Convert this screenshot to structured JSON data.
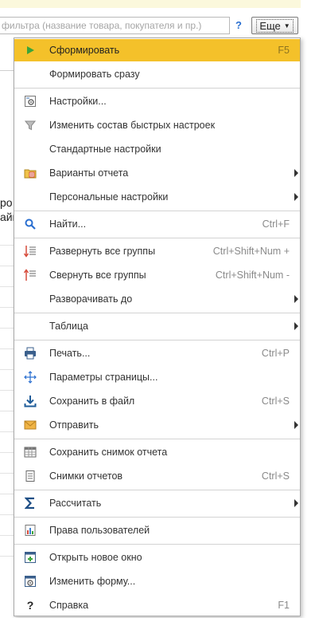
{
  "background": {
    "search_placeholder": "фильтра (название товара, покупателя и пр.)",
    "help_label": "?",
    "more_button_label": "Еще",
    "partial_text_1": "ро",
    "partial_text_2": "айм"
  },
  "menu": {
    "items": [
      {
        "label": "Сформировать",
        "shortcut": "F5",
        "icon": "play-icon"
      },
      {
        "label": "Формировать сразу",
        "shortcut": "",
        "icon": ""
      },
      {
        "label": "Настройки...",
        "shortcut": "",
        "icon": "settings-icon"
      },
      {
        "label": "Изменить состав быстрых настроек",
        "shortcut": "",
        "icon": "filter-icon"
      },
      {
        "label": "Стандартные настройки",
        "shortcut": "",
        "icon": ""
      },
      {
        "label": "Варианты отчета",
        "shortcut": "",
        "icon": "report-variants-icon",
        "submenu": true
      },
      {
        "label": "Персональные настройки",
        "shortcut": "",
        "icon": "",
        "submenu": true
      },
      {
        "label": "Найти...",
        "shortcut": "Ctrl+F",
        "icon": "search-icon"
      },
      {
        "label": "Развернуть все группы",
        "shortcut": "Ctrl+Shift+Num +",
        "icon": "expand-groups-icon"
      },
      {
        "label": "Свернуть все группы",
        "shortcut": "Ctrl+Shift+Num -",
        "icon": "collapse-groups-icon"
      },
      {
        "label": "Разворачивать до",
        "shortcut": "",
        "icon": "",
        "submenu": true
      },
      {
        "label": "Таблица",
        "shortcut": "",
        "icon": "",
        "submenu": true
      },
      {
        "label": "Печать...",
        "shortcut": "Ctrl+P",
        "icon": "print-icon"
      },
      {
        "label": "Параметры страницы...",
        "shortcut": "",
        "icon": "page-setup-icon"
      },
      {
        "label": "Сохранить в файл",
        "shortcut": "Ctrl+S",
        "icon": "save-file-icon"
      },
      {
        "label": "Отправить",
        "shortcut": "",
        "icon": "mail-icon",
        "submenu": true
      },
      {
        "label": "Сохранить снимок отчета",
        "shortcut": "",
        "icon": "snapshot-save-icon"
      },
      {
        "label": "Снимки отчетов",
        "shortcut": "Ctrl+S",
        "icon": "snapshots-icon"
      },
      {
        "label": "Рассчитать",
        "shortcut": "",
        "icon": "sigma-icon",
        "submenu": true
      },
      {
        "label": "Права пользователей",
        "shortcut": "",
        "icon": "user-rights-icon"
      },
      {
        "label": "Открыть новое окно",
        "shortcut": "",
        "icon": "new-window-icon"
      },
      {
        "label": "Изменить форму...",
        "shortcut": "",
        "icon": "change-form-icon"
      },
      {
        "label": "Справка",
        "shortcut": "F1",
        "icon": "help-icon"
      }
    ]
  },
  "colors": {
    "selected_item_bg": "#f4c12a",
    "accent_blue": "#2a6fd0",
    "play_green": "#3aa53a"
  }
}
